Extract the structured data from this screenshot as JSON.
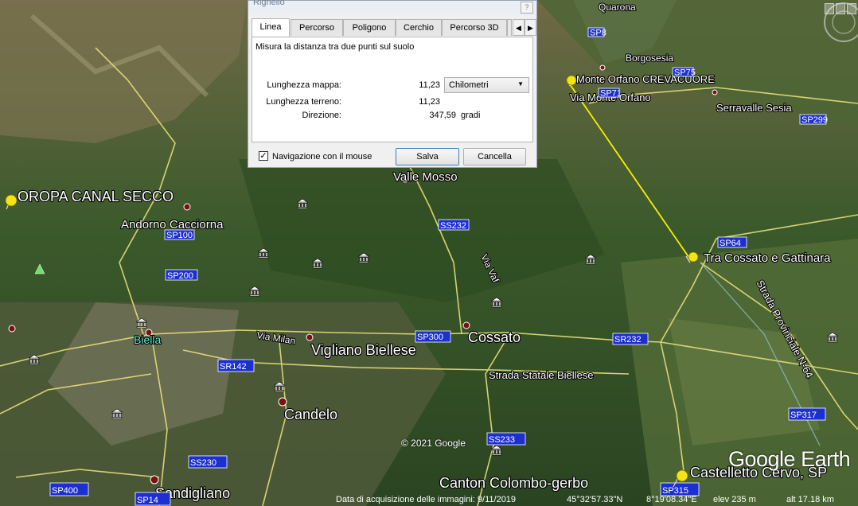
{
  "dialog": {
    "title": "Righello",
    "help": "?",
    "tabs": [
      "Linea",
      "Percorso",
      "Poligono",
      "Cerchio",
      "Percorso 3D"
    ],
    "description": "Misura la distanza tra due punti sul suolo",
    "map_length_label": "Lunghezza mappa:",
    "map_length_value": "11,23",
    "ground_length_label": "Lunghezza terreno:",
    "ground_length_value": "11,23",
    "direction_label": "Direzione:",
    "direction_value": "347,59",
    "direction_unit": "gradi",
    "unit_selected": "Chilometri",
    "mouse_nav_label": "Navigazione con il mouse",
    "mouse_nav_checked": true,
    "save_label": "Salva",
    "cancel_label": "Cancella"
  },
  "map": {
    "places": {
      "quarona": "Quarona",
      "borgosesia": "Borgosesia",
      "monte_orfano": "Monte Orfano CREVACUORE",
      "via_monte_orfano": "Via Monte Orfano",
      "serravalle": "Serravalle Sesia",
      "oropa": "OROPA CANAL SECCO",
      "andorno": "Andorno Cacciorna",
      "valle_mosso": "Valle Mosso",
      "tra_cossato": "Tra Cossato e Gattinara",
      "biella": "Biella",
      "via_milan": "Via Milan",
      "vigliano": "Vigliano Biellese",
      "cossato": "Cossato",
      "via_vaf": "Via Vaf",
      "strada_statale": "Strada Statale Biellese",
      "strada_provinciale": "Strada Provinciale N-64",
      "candelo": "Candelo",
      "sandigliano": "Sandigliano",
      "canton": "Canton Colombo-gerbo",
      "castelletto": "Castelletto Cervo, SP"
    },
    "roads": {
      "sp8": "SP8",
      "sp75": "SP75",
      "sp71": "SP71",
      "sp299": "SP299",
      "sp100": "SP100",
      "sp200": "SP200",
      "ss232": "SS232",
      "sp64": "SP64",
      "sp300": "SP300",
      "sr232": "SR232",
      "sr142": "SR142",
      "ss233": "SS233",
      "ss230": "SS230",
      "sp317": "SP317",
      "sp400": "SP400",
      "sp14": "SP14",
      "sp315": "SP315"
    },
    "copyright": "© 2021 Google",
    "brand": "Google Earth"
  },
  "status": {
    "imagery_date": "Data di acquisizione delle immagini: 9/11/2019",
    "latitude": "45°32'57.33\"N",
    "longitude": "8°19'08.34\"E",
    "elevation": "elev   235 m",
    "altitude": "alt  17.18 km"
  },
  "colors": {
    "measure_line": "#f4f200",
    "pin": "#f5e312",
    "road_shield": "#1c2fcf",
    "roads": "#e8df7a"
  },
  "icons": [
    "museum-icon",
    "pin-icon",
    "tree-icon",
    "compass-icon"
  ]
}
